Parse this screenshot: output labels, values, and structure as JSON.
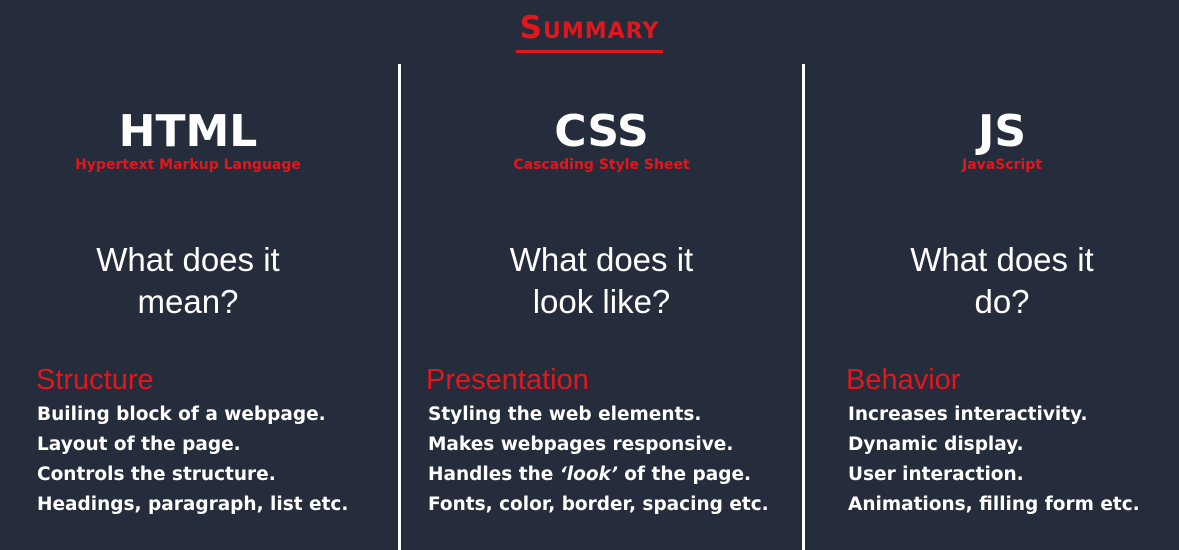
{
  "title": "Summary",
  "colors": {
    "background": "#252c3b",
    "accent": "#e1171e",
    "text": "#ffffff"
  },
  "columns": [
    {
      "name": "HTML",
      "full_name": "Hypertext Markup Language",
      "question_lines": [
        "What does it",
        "mean?"
      ],
      "category": "Structure",
      "points": [
        "Builing block of a webpage.",
        "Layout of the page.",
        "Controls the structure.",
        "Headings, paragraph, list etc."
      ]
    },
    {
      "name": "CSS",
      "full_name": "Cascading Style Sheet",
      "question_lines": [
        "What does it",
        "look like?"
      ],
      "category": "Presentation",
      "points": [
        "Styling the web elements.",
        "Makes webpages responsive.",
        {
          "before": "Handles the ",
          "emphasis": "‘look’",
          "after": " of the page."
        },
        "Fonts, color, border, spacing etc."
      ]
    },
    {
      "name": "JS",
      "full_name": "JavaScript",
      "question_lines": [
        "What does it",
        "do?"
      ],
      "category": "Behavior",
      "points": [
        "Increases interactivity.",
        "Dynamic display.",
        "User interaction.",
        "Animations, filling form etc."
      ]
    }
  ]
}
